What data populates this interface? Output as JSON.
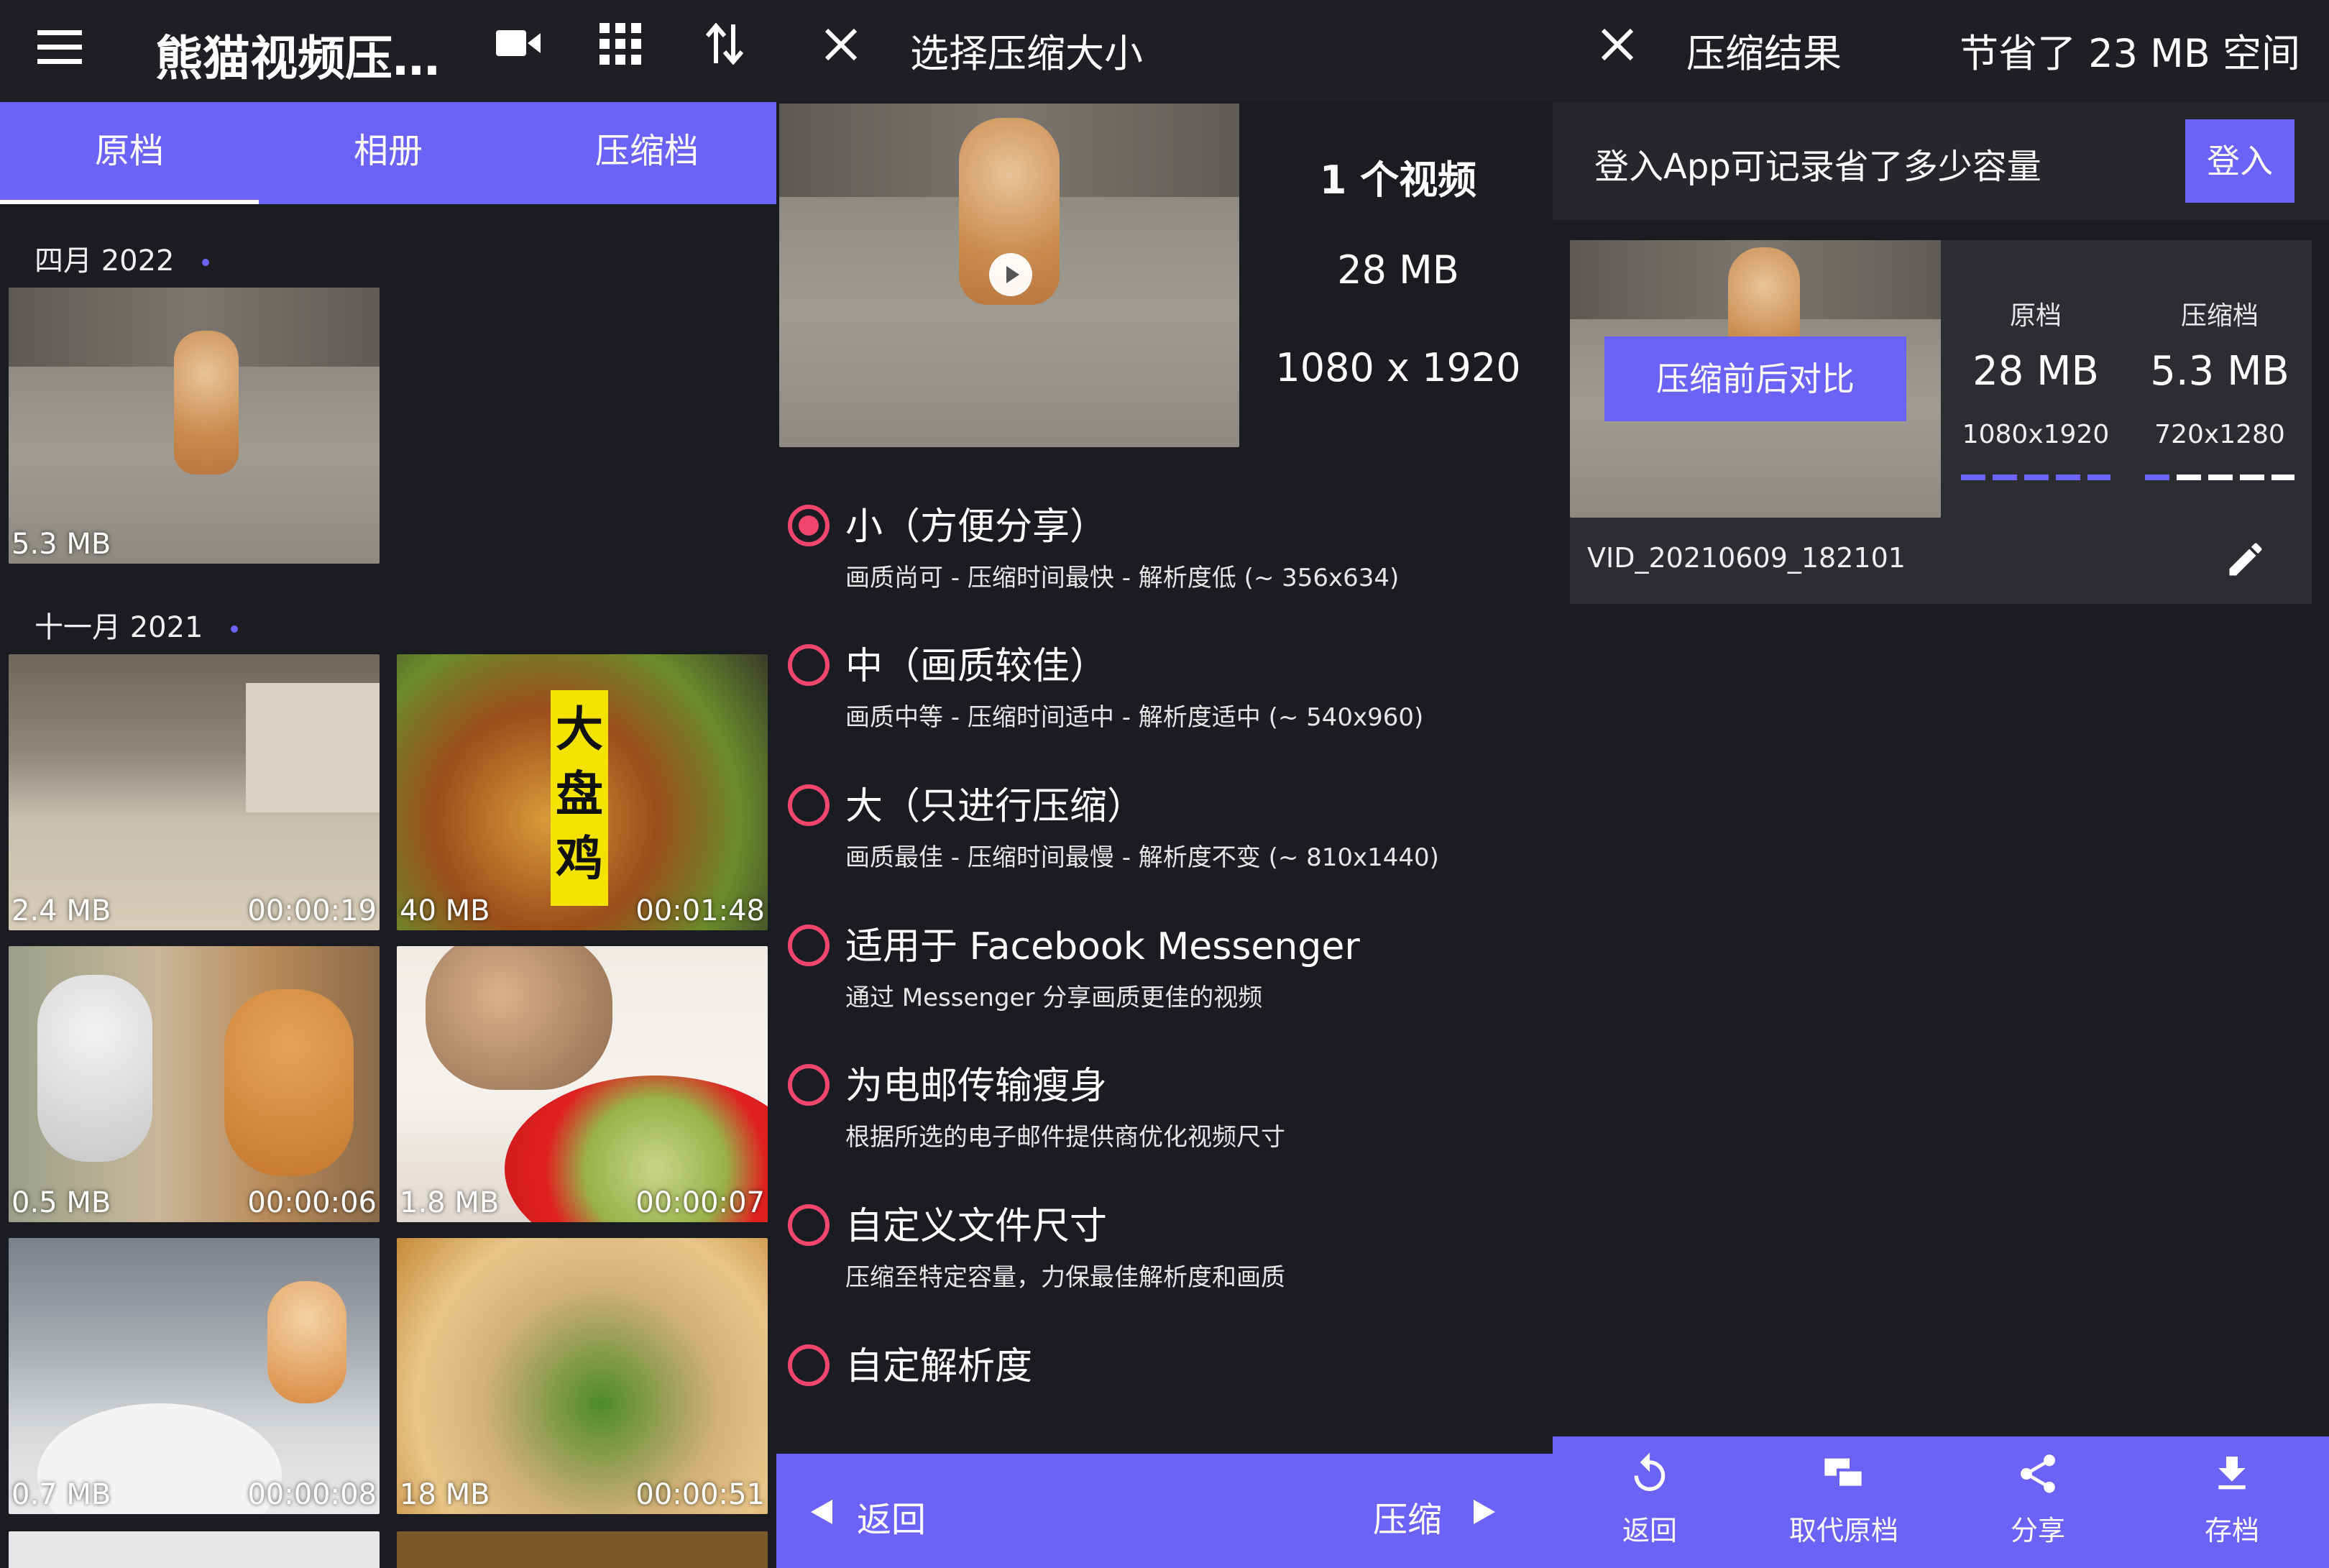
{
  "panel1": {
    "title": "熊猫视频压…",
    "tabs": [
      "原档",
      "相册",
      "压缩档"
    ],
    "active_tab": 0,
    "sections": [
      {
        "label": "四月 2022",
        "items": [
          {
            "size": "5.3 MB",
            "duration": ""
          }
        ]
      },
      {
        "label": "十一月 2021",
        "items": [
          {
            "size": "2.4 MB",
            "duration": "00:00:19"
          },
          {
            "size": "40 MB",
            "duration": "00:01:48"
          },
          {
            "size": "0.5 MB",
            "duration": "00:00:06"
          },
          {
            "size": "1.8 MB",
            "duration": "00:00:07"
          },
          {
            "size": "0.7 MB",
            "duration": "00:00:08"
          },
          {
            "size": "18 MB",
            "duration": "00:00:51"
          }
        ]
      }
    ],
    "thumb_overlay_text": "大盘鸡"
  },
  "panel2": {
    "title": "选择压缩大小",
    "info": {
      "count": "1 个视频",
      "size": "28 MB",
      "resolution": "1080 x 1920"
    },
    "options": [
      {
        "title": "小（方便分享）",
        "desc": "画质尚可 - 压缩时间最快 - 解析度低 (~ 356x634)",
        "selected": true
      },
      {
        "title": "中（画质较佳）",
        "desc": "画质中等 - 压缩时间适中 - 解析度适中 (~ 540x960)",
        "selected": false
      },
      {
        "title": "大（只进行压缩）",
        "desc": "画质最佳 - 压缩时间最慢 - 解析度不变 (~ 810x1440)",
        "selected": false
      },
      {
        "title": "适用于 Facebook Messenger",
        "desc": "通过 Messenger 分享画质更佳的视频",
        "selected": false
      },
      {
        "title": "为电邮传输瘦身",
        "desc": "根据所选的电子邮件提供商优化视频尺寸",
        "selected": false
      },
      {
        "title": "自定义文件尺寸",
        "desc": "压缩至特定容量，力保最佳解析度和画质",
        "selected": false
      },
      {
        "title": "自定解析度",
        "desc": "",
        "selected": false
      }
    ],
    "back_label": "返回",
    "compress_label": "压缩"
  },
  "panel3": {
    "title": "压缩结果",
    "saved": "节省了 23 MB 空间",
    "login_prompt": "登入App可记录省了多少容量",
    "login_button": "登入",
    "compare_button": "压缩前后对比",
    "original": {
      "label": "原档",
      "size": "28 MB",
      "resolution": "1080x1920"
    },
    "compressed": {
      "label": "压缩档",
      "size": "5.3 MB",
      "resolution": "720x1280"
    },
    "filename": "VID_20210609_182101",
    "actions": [
      "返回",
      "取代原档",
      "分享",
      "存档"
    ]
  },
  "colors": {
    "accent": "#6b63f5",
    "radio": "#f0466e",
    "background": "#1b1c21",
    "bar": "#1e1f24",
    "card": "#2c2d33"
  }
}
